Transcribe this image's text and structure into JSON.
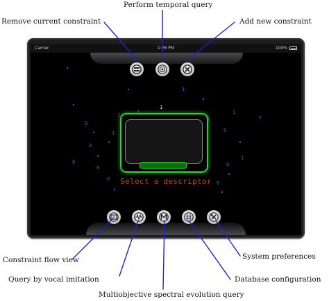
{
  "callouts": {
    "remove_constraint": "Remove current constraint",
    "temporal_query": "Perform temporal query",
    "add_constraint": "Add new constraint",
    "constraint_flow_view": "Constraint flow view",
    "vocal_imitation": "Query by vocal imitation",
    "spectral_query": "Multiobjective spectral evolution query",
    "system_preferences": "System preferences",
    "database_configuration": "Database configuration"
  },
  "statusbar": {
    "carrier": "Carrier",
    "time": "1:26 PM",
    "battery": "100%"
  },
  "main": {
    "descriptor_label": "Select a descriptor"
  },
  "colors": {
    "accent_green": "#27d327",
    "label_red": "#c7412a",
    "callout_line": "#2222cc",
    "digit_blue": "#2f63e6"
  },
  "background_digits": [
    "1",
    "1",
    "1",
    "0",
    "0",
    "0",
    "1",
    "0",
    "1",
    "0",
    "1",
    "0",
    "1",
    "1",
    "0",
    "0"
  ]
}
